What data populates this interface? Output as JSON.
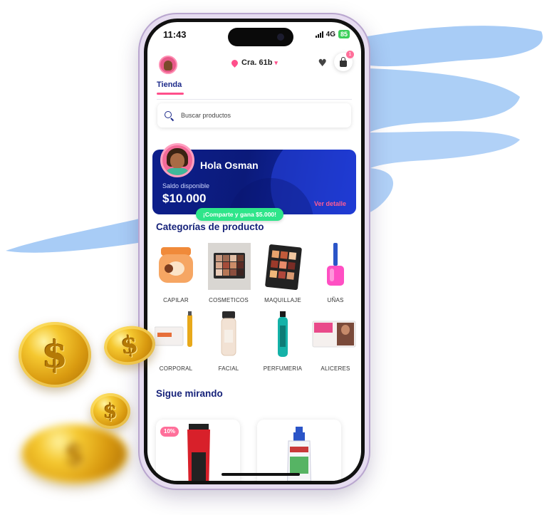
{
  "status": {
    "time": "11:43",
    "network": "4G",
    "battery": "85"
  },
  "header": {
    "location": "Cra. 61b",
    "cart_count": "1"
  },
  "tabs": [
    {
      "label": "Tienda",
      "active": true
    }
  ],
  "search": {
    "placeholder": "Buscar productos"
  },
  "balance_card": {
    "greeting": "Hola Osman",
    "balance_label": "Saldo disponible",
    "balance_value": "$10.000",
    "detail_link": "Ver detalle",
    "share_button": "¡Comparte y gana $5.000!"
  },
  "categories": {
    "title": "Categorías de producto",
    "items": [
      {
        "label": "CAPILAR",
        "icon": "hair-cream-jar-icon"
      },
      {
        "label": "COSMETICOS",
        "icon": "eyeshadow-palette-icon"
      },
      {
        "label": "MAQUILLAJE",
        "icon": "makeup-palette-icon"
      },
      {
        "label": "UÑAS",
        "icon": "nail-polish-icon"
      },
      {
        "label": "CORPORAL",
        "icon": "body-ampoule-icon"
      },
      {
        "label": "FACIAL",
        "icon": "facial-bottle-icon"
      },
      {
        "label": "PERFUMERIA",
        "icon": "perfume-bottle-icon"
      },
      {
        "label": "ALICERES",
        "icon": "hair-relaxer-box-icon"
      }
    ]
  },
  "keep_watching": {
    "title": "Sigue mirando",
    "products": [
      {
        "discount": "10%"
      },
      {
        "discount": ""
      }
    ]
  },
  "colors": {
    "brand_blue": "#16227a",
    "accent_pink": "#ff4f8b",
    "share_green": "#2ee58a"
  }
}
